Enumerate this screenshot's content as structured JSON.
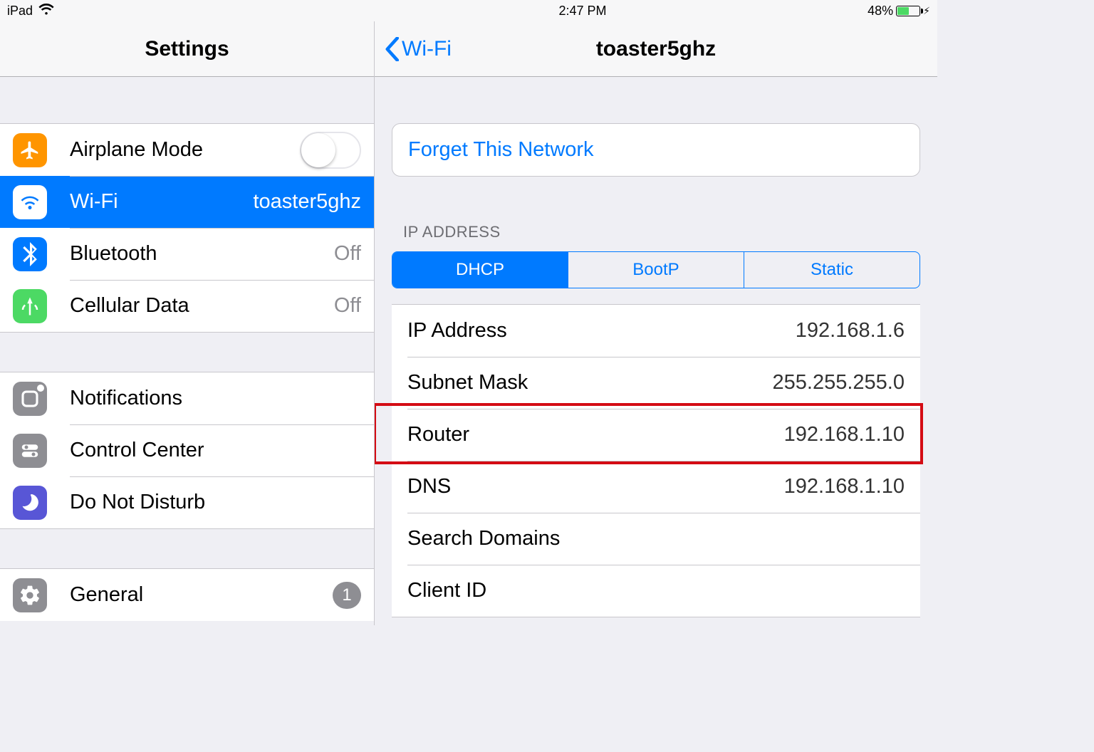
{
  "status": {
    "device": "iPad",
    "time": "2:47 PM",
    "battery_percent": "48%",
    "charging_glyph": "⚡︎"
  },
  "sidebar": {
    "title": "Settings",
    "items": [
      {
        "label": "Airplane Mode",
        "icon": "airplane",
        "type": "toggle",
        "toggled": false
      },
      {
        "label": "Wi-Fi",
        "icon": "wifi",
        "value": "toaster5ghz",
        "selected": true
      },
      {
        "label": "Bluetooth",
        "icon": "bluetooth",
        "value": "Off"
      },
      {
        "label": "Cellular Data",
        "icon": "cellular",
        "value": "Off"
      }
    ],
    "items2": [
      {
        "label": "Notifications",
        "icon": "notifications"
      },
      {
        "label": "Control Center",
        "icon": "controlcenter"
      },
      {
        "label": "Do Not Disturb",
        "icon": "dnd"
      }
    ],
    "items3": [
      {
        "label": "General",
        "icon": "general",
        "badge": "1"
      }
    ]
  },
  "detail": {
    "back_label": "Wi-Fi",
    "title": "toaster5ghz",
    "forget_label": "Forget This Network",
    "ip_section_header": "IP ADDRESS",
    "segments": [
      "DHCP",
      "BootP",
      "Static"
    ],
    "active_segment": 0,
    "rows": [
      {
        "label": "IP Address",
        "value": "192.168.1.6"
      },
      {
        "label": "Subnet Mask",
        "value": "255.255.255.0"
      },
      {
        "label": "Router",
        "value": "192.168.1.10",
        "highlighted": true
      },
      {
        "label": "DNS",
        "value": "192.168.1.10"
      },
      {
        "label": "Search Domains",
        "value": ""
      },
      {
        "label": "Client ID",
        "value": ""
      }
    ]
  },
  "colors": {
    "accent": "#007aff",
    "highlight_border": "#d40c14"
  }
}
